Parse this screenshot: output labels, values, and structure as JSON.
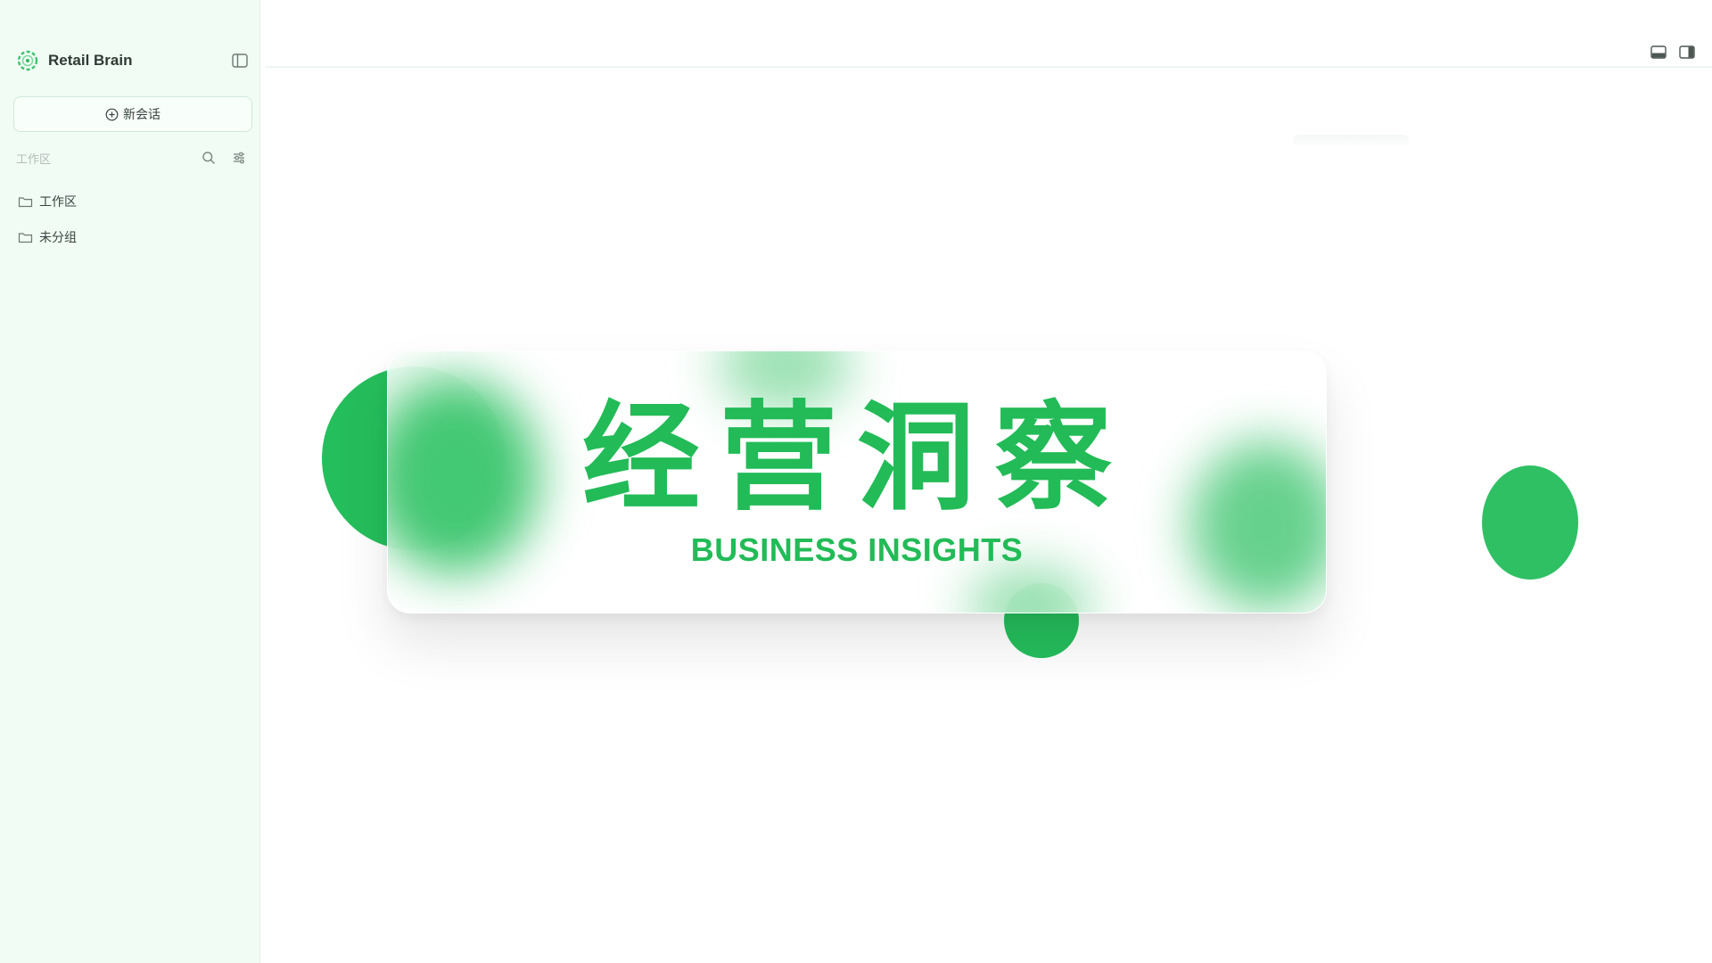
{
  "app": {
    "brand_name": "Retail Brain"
  },
  "sidebar": {
    "new_chat_label": "新会话",
    "section_title": "工作区",
    "folders": [
      {
        "label": "工作区"
      },
      {
        "label": "未分组"
      }
    ]
  },
  "hero": {
    "title": "经营洞察",
    "subtitle": "BUSINESS INSIGHTS"
  },
  "icons": {
    "brand": "retail-brain-logo-icon",
    "sidebar_toggle": "sidebar-toggle-icon",
    "new_chat": "plus-circle-icon",
    "search": "search-icon",
    "filter": "sliders-icon",
    "folder": "folder-icon",
    "bottom_panel": "bottom-panel-icon",
    "right_panel": "right-panel-icon"
  },
  "colors": {
    "accent": "#22bb57",
    "sidebar_bg": "#f1fcf5"
  }
}
